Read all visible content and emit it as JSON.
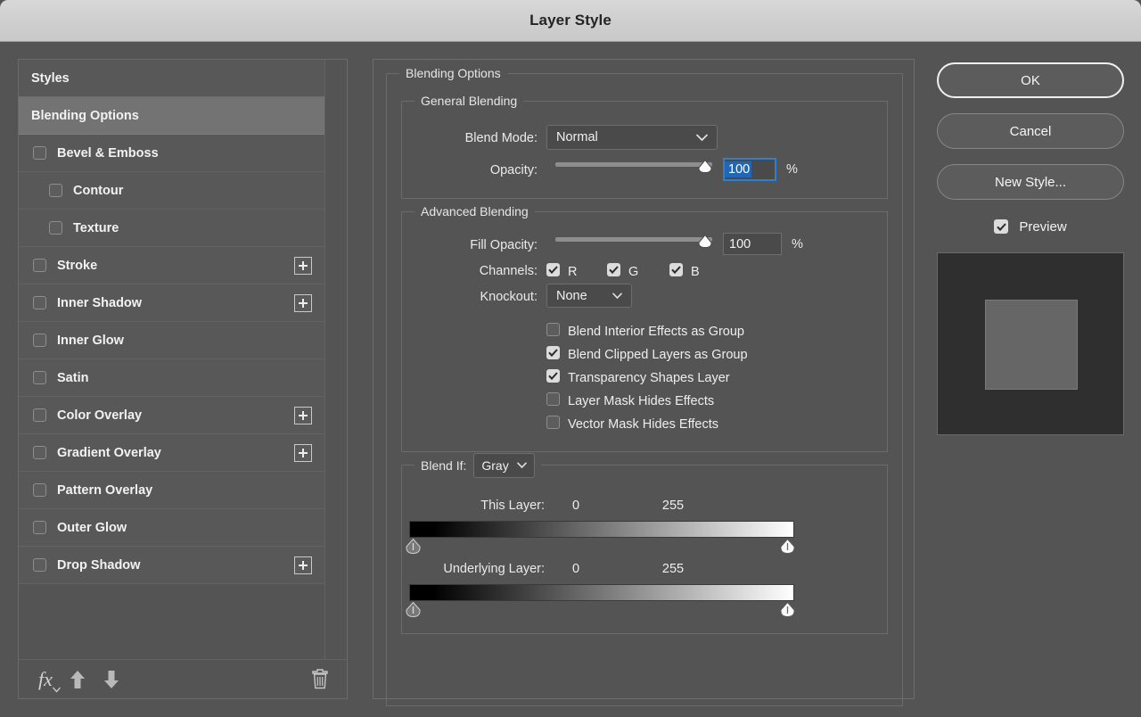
{
  "window": {
    "title": "Layer Style"
  },
  "styles_panel": {
    "header_label": "Styles",
    "selected_label": "Blending Options",
    "effects": [
      {
        "label": "Bevel & Emboss",
        "checked": false,
        "indent": false,
        "plus": false
      },
      {
        "label": "Contour",
        "checked": false,
        "indent": true,
        "plus": false
      },
      {
        "label": "Texture",
        "checked": false,
        "indent": true,
        "plus": false
      },
      {
        "label": "Stroke",
        "checked": false,
        "indent": false,
        "plus": true
      },
      {
        "label": "Inner Shadow",
        "checked": false,
        "indent": false,
        "plus": true
      },
      {
        "label": "Inner Glow",
        "checked": false,
        "indent": false,
        "plus": false
      },
      {
        "label": "Satin",
        "checked": false,
        "indent": false,
        "plus": false
      },
      {
        "label": "Color Overlay",
        "checked": false,
        "indent": false,
        "plus": true
      },
      {
        "label": "Gradient Overlay",
        "checked": false,
        "indent": false,
        "plus": true
      },
      {
        "label": "Pattern Overlay",
        "checked": false,
        "indent": false,
        "plus": false
      },
      {
        "label": "Outer Glow",
        "checked": false,
        "indent": false,
        "plus": false
      },
      {
        "label": "Drop Shadow",
        "checked": false,
        "indent": false,
        "plus": true
      }
    ],
    "toolbar": {
      "fx_icon": "fx-icon",
      "move_up_icon": "arrow-up-icon",
      "move_down_icon": "arrow-down-icon",
      "delete_icon": "trash-icon"
    }
  },
  "main": {
    "section_title": "Blending Options",
    "general_blending": {
      "legend": "General Blending",
      "blend_mode_label": "Blend Mode:",
      "blend_mode_value": "Normal",
      "opacity_label": "Opacity:",
      "opacity_value": "100",
      "opacity_percent": "%",
      "opacity_slider_pct": 100
    },
    "advanced_blending": {
      "legend": "Advanced Blending",
      "fill_opacity_label": "Fill Opacity:",
      "fill_opacity_value": "100",
      "fill_opacity_percent": "%",
      "fill_opacity_slider_pct": 100,
      "channels_label": "Channels:",
      "channels": [
        {
          "label": "R",
          "checked": true
        },
        {
          "label": "G",
          "checked": true
        },
        {
          "label": "B",
          "checked": true
        }
      ],
      "knockout_label": "Knockout:",
      "knockout_value": "None",
      "options": [
        {
          "label": "Blend Interior Effects as Group",
          "checked": false
        },
        {
          "label": "Blend Clipped Layers as Group",
          "checked": true
        },
        {
          "label": "Transparency Shapes Layer",
          "checked": true
        },
        {
          "label": "Layer Mask Hides Effects",
          "checked": false
        },
        {
          "label": "Vector Mask Hides Effects",
          "checked": false
        }
      ]
    },
    "blend_if": {
      "legend": "Blend If:",
      "channel_value": "Gray",
      "this_layer_label": "This Layer:",
      "this_layer_min": "0",
      "this_layer_max": "255",
      "underlying_layer_label": "Underlying Layer:",
      "underlying_layer_min": "0",
      "underlying_layer_max": "255"
    }
  },
  "buttons": {
    "ok": "OK",
    "cancel": "Cancel",
    "new_style": "New Style...",
    "preview_label": "Preview",
    "preview_checked": true
  },
  "colors": {
    "dialog_bg": "#545454",
    "titlebar_bg": "#d2d2d2",
    "row_bg": "#585858",
    "row_selected_bg": "#737373",
    "accent_focus": "#2f7fd1",
    "selection_blue": "#2266b8",
    "text": "#f0f0f0"
  }
}
